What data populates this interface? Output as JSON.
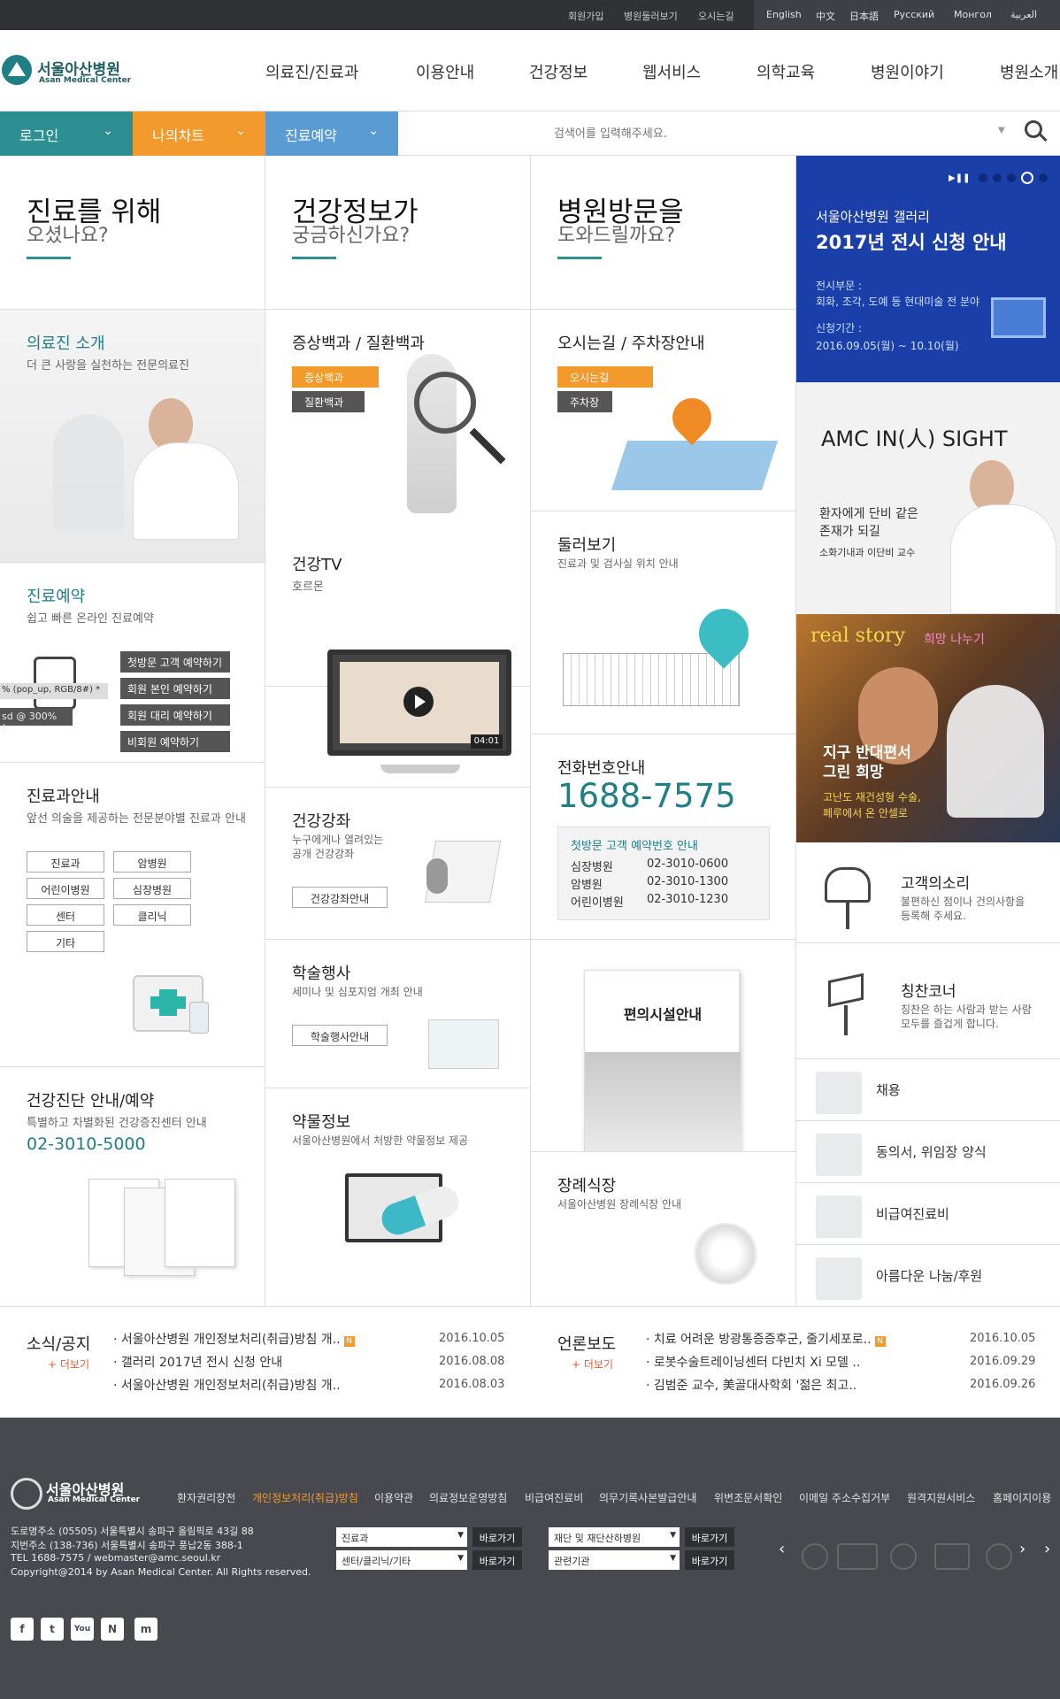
{
  "util": {
    "join": "회원가입",
    "allview": "병원둘러보기",
    "map": "오시는길"
  },
  "langs": [
    "English",
    "中文",
    "日本語",
    "Русский",
    "Монгол",
    "العربية"
  ],
  "brand": {
    "name": "서울아산병원",
    "sub": "Asan Medical Center"
  },
  "gnb": [
    "의료진/진료과",
    "이용안내",
    "건강정보",
    "웹서비스",
    "의학교육",
    "병원이야기",
    "병원소개"
  ],
  "quick": {
    "login": "로그인",
    "mychart": "나의차트",
    "reserve": "진료예약"
  },
  "search": {
    "placeholder": "검색어를 입력해주세요."
  },
  "col1": {
    "h1": "진료를 위해",
    "h2": "오셨나요?",
    "doctor_t": "의료진 소개",
    "doctor_s": "더 큰 사랑을 실천하는 전문의료진",
    "rsv_t": "진료예약",
    "rsv_s": "쉽고 빠른 온라인 진료예약",
    "rsv_btns": [
      "첫방문 고객 예약하기",
      "회원 본인 예약하기",
      "회원 대리 예약하기",
      "비회원 예약하기"
    ],
    "tip1": "% (pop_up, RGB/8#) *",
    "tip2": "sd @ 300% (...",
    "dept_t": "진료과안내",
    "dept_s": "앞선 의술을 제공하는 전문분야별 진료과 안내",
    "dept_btns": [
      "진료과",
      "암병원",
      "어린이병원",
      "심장병원",
      "센터",
      "클리닉",
      "기타"
    ],
    "chk_t": "건강진단 안내/예약",
    "chk_s": "특별하고 차별화된 건강증진센터 안내",
    "chk_tel": "02-3010-5000"
  },
  "col2": {
    "h1": "건강정보가",
    "h2": "궁금하신가요?",
    "sym_t": "증상백과 / 질환백과",
    "sym_b1": "증상백과",
    "sym_b2": "질환백과",
    "tv_t": "건강TV",
    "tv_s": "호르몬",
    "tv_time": "04:01",
    "lec_t": "건강강좌",
    "lec_s1": "누구에게나 열려있는",
    "lec_s2": "공개 건강강좌",
    "lec_btn": "건강강좌안내",
    "aca_t": "학술행사",
    "aca_s": "세미나 및 심포지엄 개최 안내",
    "aca_btn": "학술행사안내",
    "drug_t": "약물정보",
    "drug_s": "서울아산병원에서 처방한 약물정보 제공"
  },
  "col3": {
    "h1": "병원방문을",
    "h2": "도와드릴까요?",
    "way_t": "오시는길 / 주차장안내",
    "way_b1": "오시는길",
    "way_b2": "주차장",
    "look_t": "둘러보기",
    "look_s": "진료과 및 검사실 위치 안내",
    "tel_t": "전화번호안내",
    "tel": "1688-7575",
    "tel_box_t": "첫방문 고객 예약번호 안내",
    "tel_rows": [
      [
        "심장병원",
        "02-3010-0600"
      ],
      [
        "암병원",
        "02-3010-1300"
      ],
      [
        "어린이병원",
        "02-3010-1230"
      ]
    ],
    "conv_t": "편의시설안내",
    "fun_t": "장례식장",
    "fun_s": "서울아산병원 장례식장 안내"
  },
  "col4": {
    "bn_t1": "서울아산병원 갤러리",
    "bn_t2": "2017년 전시 신청 안내",
    "bn_d1": "전시부문 :",
    "bn_d2": "회화, 조각, 도예 등 현대미술 전 분야",
    "bn_d3": "신청기간 :",
    "bn_d4": "2016.09.05(월) ~ 10.10(월)",
    "ins_t": "AMC IN(人) SIGHT",
    "ins_s1": "환자에게 단비 같은",
    "ins_s2": "존재가 되길",
    "ins_s3": "소화기내과 이단비 교수",
    "rs_t": "real story",
    "rs_s1": "희망 나누기",
    "rs_h1": "지구 반대편서",
    "rs_h2": "그린 희망",
    "rs_d1": "고난도 재건성형 수술,",
    "rs_d2": "페루에서 온 안셀로",
    "voice_t": "고객의소리",
    "voice_s1": "불편하신 점이나 건의사항을",
    "voice_s2": "등록해 주세요.",
    "praise_t": "칭찬코너",
    "praise_s1": "칭찬은 하는 사람과 받는 사람",
    "praise_s2": "모두를 즐겁게 합니다.",
    "items": [
      "채용",
      "동의서, 위임장 양식",
      "비급여진료비",
      "아름다운 나눔/후원"
    ]
  },
  "notice": {
    "title": "소식/공지",
    "more": "+ 더보기",
    "items": [
      [
        "서울아산병원 개인정보처리(취급)방침 개..",
        "2016.10.05"
      ],
      [
        "갤러리 2017년 전시 신청 안내",
        "2016.08.08"
      ],
      [
        "서울아산병원 개인정보처리(취급)방침 개..",
        "2016.08.03"
      ]
    ]
  },
  "press": {
    "title": "언론보도",
    "more": "+ 더보기",
    "items": [
      [
        "치료 어려운 방광통증증후군, 줄기세포로..",
        "2016.10.05"
      ],
      [
        "로봇수술트레이닝센터 다빈치 Xi 모델 ..",
        "2016.09.29"
      ],
      [
        "김범준 교수, 美골대사학회 '젊은 최고..",
        "2016.09.26"
      ]
    ]
  },
  "footer": {
    "links": [
      "환자권리장전",
      "개인정보처리(취급)방침",
      "이용약관",
      "의료정보운영방침",
      "비급여진료비",
      "의무기록사본발급안내",
      "위변조문서확인",
      "이메일 주소수집거부",
      "원격지원서비스",
      "홈페이지이용"
    ],
    "addr1": "도로명주소 (05505) 서울특별시 송파구 올림픽로 43길 88",
    "addr2": "지번주소 (138-736) 서울특별시 송파구 풍납2동 388-1",
    "addr3": "TEL 1688-7575 / webmaster@amc.seoul.kr",
    "addr4": "Copyright@2014 by Asan Medical Center. All Rights reserved.",
    "sel": [
      "진료과",
      "센터/클리닉/기타",
      "재단 및 재단산하병원",
      "관련기관"
    ],
    "go": "바로가기",
    "sns": [
      "f",
      "t",
      "You",
      "N",
      "m"
    ]
  },
  "colors": {
    "teal": "#1f7f85",
    "orange": "#f39a2c",
    "blue": "#5b9bd3",
    "navy": "#1a3fa8",
    "footer": "#47494e"
  }
}
